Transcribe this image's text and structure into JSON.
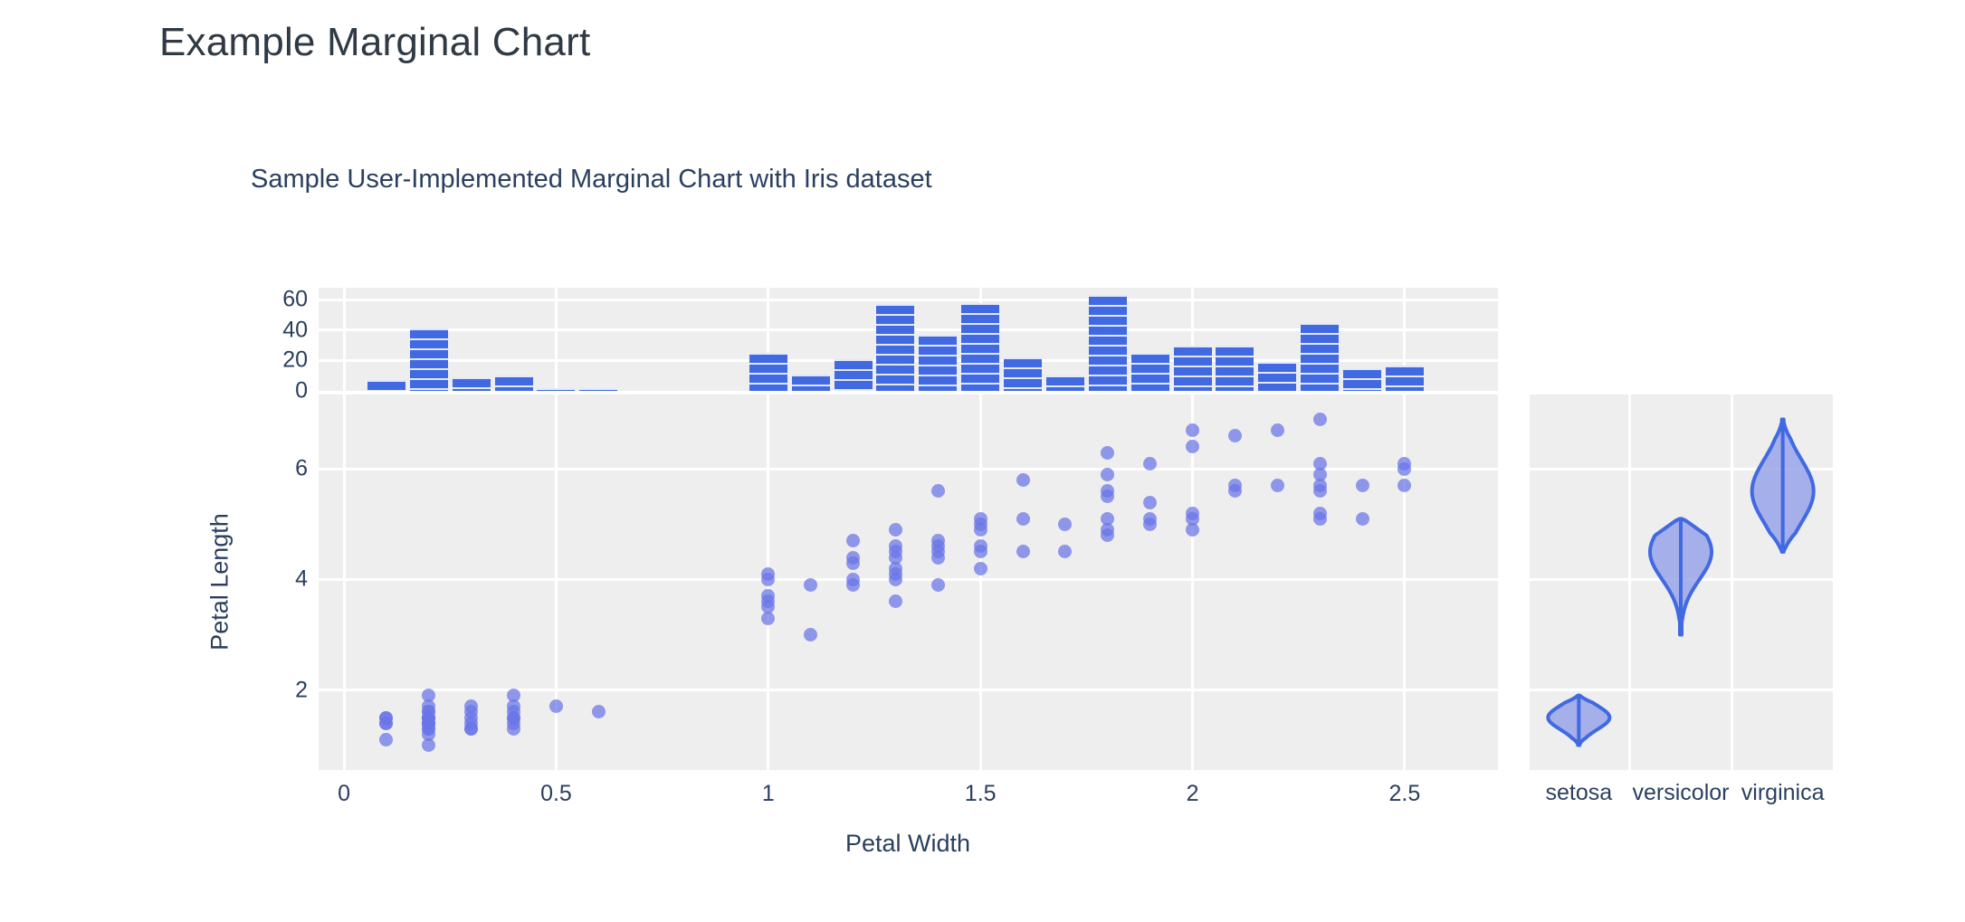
{
  "page": {
    "title": "Example Marginal Chart"
  },
  "chart_data": {
    "type": "scatter",
    "title": "Sample User-Implemented Marginal Chart with Iris dataset",
    "xlabel": "Petal Width",
    "ylabel": "Petal Length",
    "xlim": [
      -0.06,
      2.72
    ],
    "ylim": [
      0.55,
      7.35
    ],
    "grid": true,
    "legend": false,
    "colors": {
      "marker": "#6a75e8",
      "bar": "#4169e1",
      "violin_line": "#4169e1",
      "violin_fill": "#8c9ae8",
      "panel_background": "#eeeeee",
      "gridline": "#ffffff",
      "text": "#2a3f5f",
      "page_title": "#2f3a45"
    },
    "x_ticks": [
      "0",
      "0.5",
      "1",
      "1.5",
      "2",
      "2.5"
    ],
    "x_tick_values": [
      0,
      0.5,
      1,
      1.5,
      2,
      2.5
    ],
    "y_ticks": [
      "2",
      "4",
      "6"
    ],
    "y_tick_values": [
      2,
      4,
      6
    ],
    "points": [
      {
        "x": 0.1,
        "y": 1.5
      },
      {
        "x": 0.1,
        "y": 1.4
      },
      {
        "x": 0.1,
        "y": 1.4
      },
      {
        "x": 0.1,
        "y": 1.5
      },
      {
        "x": 0.1,
        "y": 1.1
      },
      {
        "x": 0.2,
        "y": 1.4
      },
      {
        "x": 0.2,
        "y": 1.5
      },
      {
        "x": 0.2,
        "y": 1.5
      },
      {
        "x": 0.2,
        "y": 1.3
      },
      {
        "x": 0.2,
        "y": 1.4
      },
      {
        "x": 0.2,
        "y": 1.7
      },
      {
        "x": 0.2,
        "y": 1.5
      },
      {
        "x": 0.2,
        "y": 1.6
      },
      {
        "x": 0.2,
        "y": 1.4
      },
      {
        "x": 0.2,
        "y": 1.6
      },
      {
        "x": 0.2,
        "y": 1.5
      },
      {
        "x": 0.2,
        "y": 1.4
      },
      {
        "x": 0.2,
        "y": 1.5
      },
      {
        "x": 0.2,
        "y": 1.2
      },
      {
        "x": 0.2,
        "y": 1.3
      },
      {
        "x": 0.2,
        "y": 1.4
      },
      {
        "x": 0.2,
        "y": 1.9
      },
      {
        "x": 0.2,
        "y": 1.0
      },
      {
        "x": 0.3,
        "y": 1.7
      },
      {
        "x": 0.3,
        "y": 1.4
      },
      {
        "x": 0.3,
        "y": 1.5
      },
      {
        "x": 0.3,
        "y": 1.3
      },
      {
        "x": 0.3,
        "y": 1.6
      },
      {
        "x": 0.3,
        "y": 1.3
      },
      {
        "x": 0.4,
        "y": 1.5
      },
      {
        "x": 0.4,
        "y": 1.6
      },
      {
        "x": 0.4,
        "y": 1.9
      },
      {
        "x": 0.4,
        "y": 1.4
      },
      {
        "x": 0.4,
        "y": 1.3
      },
      {
        "x": 0.4,
        "y": 1.5
      },
      {
        "x": 0.4,
        "y": 1.7
      },
      {
        "x": 0.5,
        "y": 1.7
      },
      {
        "x": 0.6,
        "y": 1.6
      },
      {
        "x": 1.0,
        "y": 4.1
      },
      {
        "x": 1.0,
        "y": 4.0
      },
      {
        "x": 1.0,
        "y": 3.7
      },
      {
        "x": 1.0,
        "y": 3.5
      },
      {
        "x": 1.0,
        "y": 3.3
      },
      {
        "x": 1.0,
        "y": 3.6
      },
      {
        "x": 1.1,
        "y": 3.9
      },
      {
        "x": 1.1,
        "y": 3.0
      },
      {
        "x": 1.2,
        "y": 4.7
      },
      {
        "x": 1.2,
        "y": 4.4
      },
      {
        "x": 1.2,
        "y": 4.3
      },
      {
        "x": 1.2,
        "y": 4.0
      },
      {
        "x": 1.2,
        "y": 3.9
      },
      {
        "x": 1.3,
        "y": 4.9
      },
      {
        "x": 1.3,
        "y": 4.5
      },
      {
        "x": 1.3,
        "y": 4.4
      },
      {
        "x": 1.3,
        "y": 4.2
      },
      {
        "x": 1.3,
        "y": 4.1
      },
      {
        "x": 1.3,
        "y": 4.0
      },
      {
        "x": 1.3,
        "y": 4.6
      },
      {
        "x": 1.3,
        "y": 3.6
      },
      {
        "x": 1.4,
        "y": 5.6
      },
      {
        "x": 1.4,
        "y": 4.7
      },
      {
        "x": 1.4,
        "y": 4.5
      },
      {
        "x": 1.4,
        "y": 4.4
      },
      {
        "x": 1.4,
        "y": 4.6
      },
      {
        "x": 1.4,
        "y": 3.9
      },
      {
        "x": 1.5,
        "y": 5.1
      },
      {
        "x": 1.5,
        "y": 5.0
      },
      {
        "x": 1.5,
        "y": 4.9
      },
      {
        "x": 1.5,
        "y": 4.5
      },
      {
        "x": 1.5,
        "y": 4.6
      },
      {
        "x": 1.5,
        "y": 4.2
      },
      {
        "x": 1.6,
        "y": 5.8
      },
      {
        "x": 1.6,
        "y": 5.1
      },
      {
        "x": 1.6,
        "y": 4.5
      },
      {
        "x": 1.7,
        "y": 5.0
      },
      {
        "x": 1.7,
        "y": 4.5
      },
      {
        "x": 1.8,
        "y": 6.3
      },
      {
        "x": 1.8,
        "y": 5.9
      },
      {
        "x": 1.8,
        "y": 5.6
      },
      {
        "x": 1.8,
        "y": 5.5
      },
      {
        "x": 1.8,
        "y": 5.1
      },
      {
        "x": 1.8,
        "y": 4.9
      },
      {
        "x": 1.8,
        "y": 4.8
      },
      {
        "x": 1.9,
        "y": 6.1
      },
      {
        "x": 1.9,
        "y": 5.4
      },
      {
        "x": 1.9,
        "y": 5.1
      },
      {
        "x": 1.9,
        "y": 5.0
      },
      {
        "x": 2.0,
        "y": 6.7
      },
      {
        "x": 2.0,
        "y": 6.4
      },
      {
        "x": 2.0,
        "y": 5.2
      },
      {
        "x": 2.0,
        "y": 5.1
      },
      {
        "x": 2.0,
        "y": 4.9
      },
      {
        "x": 2.1,
        "y": 6.6
      },
      {
        "x": 2.1,
        "y": 5.7
      },
      {
        "x": 2.1,
        "y": 5.6
      },
      {
        "x": 2.2,
        "y": 6.7
      },
      {
        "x": 2.2,
        "y": 5.7
      },
      {
        "x": 2.3,
        "y": 6.9
      },
      {
        "x": 2.3,
        "y": 6.1
      },
      {
        "x": 2.3,
        "y": 5.9
      },
      {
        "x": 2.3,
        "y": 5.7
      },
      {
        "x": 2.3,
        "y": 5.6
      },
      {
        "x": 2.3,
        "y": 5.2
      },
      {
        "x": 2.3,
        "y": 5.1
      },
      {
        "x": 2.4,
        "y": 5.7
      },
      {
        "x": 2.4,
        "y": 5.1
      },
      {
        "x": 2.5,
        "y": 6.1
      },
      {
        "x": 2.5,
        "y": 6.0
      },
      {
        "x": 2.5,
        "y": 5.7
      }
    ],
    "histogram": {
      "orientation": "vertical",
      "ylabel": "",
      "y_ticks": [
        "0",
        "20",
        "40",
        "60"
      ],
      "y_tick_values": [
        0,
        20,
        40,
        60
      ],
      "ylim": [
        0,
        68
      ],
      "bins": [
        {
          "x": 0.1,
          "count": 7
        },
        {
          "x": 0.2,
          "count": 41
        },
        {
          "x": 0.3,
          "count": 9
        },
        {
          "x": 0.4,
          "count": 10
        },
        {
          "x": 0.5,
          "count": 1
        },
        {
          "x": 0.6,
          "count": 1
        },
        {
          "x": 1.0,
          "count": 25
        },
        {
          "x": 1.1,
          "count": 11
        },
        {
          "x": 1.2,
          "count": 21
        },
        {
          "x": 1.3,
          "count": 57
        },
        {
          "x": 1.4,
          "count": 37
        },
        {
          "x": 1.5,
          "count": 58
        },
        {
          "x": 1.6,
          "count": 22
        },
        {
          "x": 1.7,
          "count": 10
        },
        {
          "x": 1.8,
          "count": 63
        },
        {
          "x": 1.9,
          "count": 25
        },
        {
          "x": 2.0,
          "count": 30
        },
        {
          "x": 2.1,
          "count": 30
        },
        {
          "x": 2.2,
          "count": 19
        },
        {
          "x": 2.3,
          "count": 45
        },
        {
          "x": 2.4,
          "count": 15
        },
        {
          "x": 2.5,
          "count": 17
        }
      ]
    },
    "violin": {
      "categories": [
        "setosa",
        "versicolor",
        "virginica"
      ],
      "series": [
        {
          "name": "setosa",
          "min": 1.0,
          "max": 1.9,
          "median": 1.5,
          "peak": 1.5
        },
        {
          "name": "versicolor",
          "min": 3.0,
          "max": 5.1,
          "median": 4.35,
          "peak": 4.5
        },
        {
          "name": "virginica",
          "min": 4.5,
          "max": 6.9,
          "median": 5.55,
          "peak": 5.6
        }
      ],
      "ylabel": "Petal Length"
    }
  }
}
